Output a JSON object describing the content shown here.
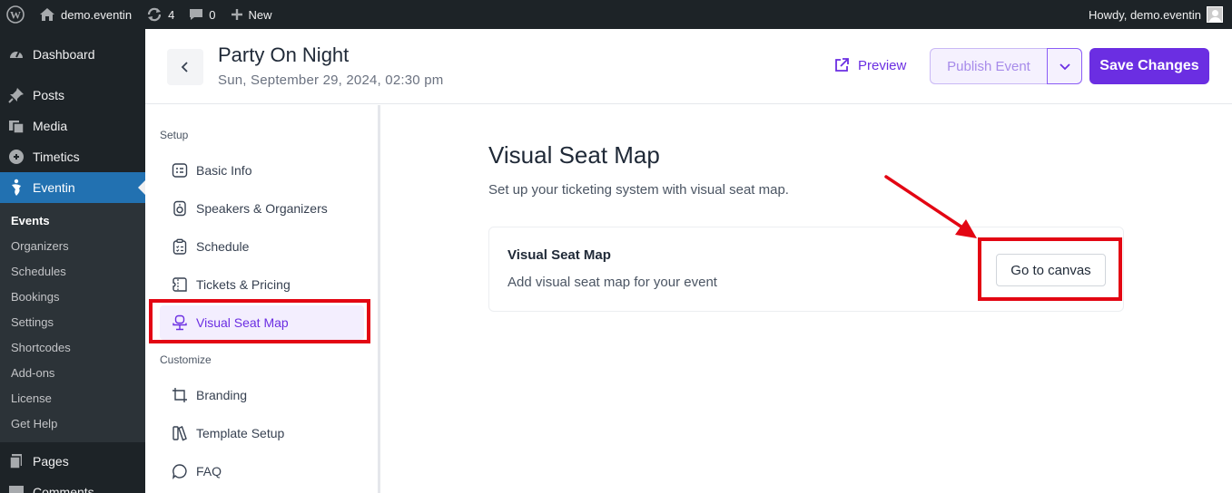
{
  "admin_bar": {
    "site_name": "demo.eventin",
    "updates_count": "4",
    "comments_count": "0",
    "new_label": "New",
    "howdy": "Howdy, demo.eventin"
  },
  "wp_menu": {
    "items_top": [
      {
        "label": "Dashboard",
        "icon": "dashboard-icon"
      },
      {
        "label": "Posts",
        "icon": "pin-icon"
      },
      {
        "label": "Media",
        "icon": "media-icon"
      },
      {
        "label": "Timetics",
        "icon": "timetics-icon"
      },
      {
        "label": "Eventin",
        "icon": "eventin-icon"
      }
    ],
    "submenu": [
      "Events",
      "Organizers",
      "Schedules",
      "Bookings",
      "Settings",
      "Shortcodes",
      "Add-ons",
      "License",
      "Get Help"
    ],
    "items_bottom": [
      {
        "label": "Pages",
        "icon": "pages-icon"
      },
      {
        "label": "Comments",
        "icon": "comments-icon"
      }
    ]
  },
  "header": {
    "title": "Party On Night",
    "date": "Sun, September 29, 2024, 02:30 pm",
    "preview_label": "Preview",
    "publish_label": "Publish Event",
    "save_label": "Save Changes"
  },
  "event_nav": {
    "setup_heading": "Setup",
    "setup_items": [
      {
        "label": "Basic Info",
        "icon": "info-card-icon"
      },
      {
        "label": "Speakers & Organizers",
        "icon": "speaker-icon"
      },
      {
        "label": "Schedule",
        "icon": "clipboard-icon"
      },
      {
        "label": "Tickets & Pricing",
        "icon": "ticket-icon"
      },
      {
        "label": "Visual Seat Map",
        "icon": "chair-icon"
      }
    ],
    "customize_heading": "Customize",
    "customize_items": [
      {
        "label": "Branding",
        "icon": "crop-icon"
      },
      {
        "label": "Template Setup",
        "icon": "book-icon"
      },
      {
        "label": "FAQ",
        "icon": "chat-icon"
      }
    ]
  },
  "main": {
    "title": "Visual Seat Map",
    "subtitle": "Set up your ticketing system with visual seat map.",
    "card_title": "Visual Seat Map",
    "card_desc": "Add visual seat map for your event",
    "canvas_button": "Go to canvas"
  },
  "colors": {
    "accent": "#6b2ee2",
    "wp_dark": "#1d2327",
    "wp_active": "#2271b1",
    "annotation_red": "#e30613"
  }
}
